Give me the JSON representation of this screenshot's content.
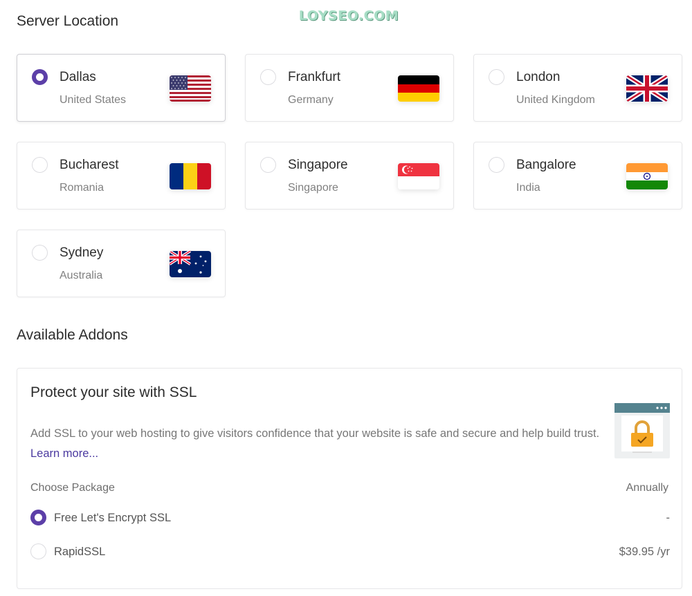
{
  "watermark": "LOYSEO.COM",
  "server_location": {
    "title": "Server Location",
    "locations": [
      {
        "city": "Dallas",
        "country": "United States",
        "flag": "us-flag-icon",
        "selected": true
      },
      {
        "city": "Frankfurt",
        "country": "Germany",
        "flag": "de-flag-icon",
        "selected": false
      },
      {
        "city": "London",
        "country": "United Kingdom",
        "flag": "gb-flag-icon",
        "selected": false
      },
      {
        "city": "Bucharest",
        "country": "Romania",
        "flag": "ro-flag-icon",
        "selected": false
      },
      {
        "city": "Singapore",
        "country": "Singapore",
        "flag": "sg-flag-icon",
        "selected": false
      },
      {
        "city": "Bangalore",
        "country": "India",
        "flag": "in-flag-icon",
        "selected": false
      },
      {
        "city": "Sydney",
        "country": "Australia",
        "flag": "au-flag-icon",
        "selected": false
      }
    ]
  },
  "addons": {
    "title": "Available Addons",
    "ssl": {
      "title": "Protect your site with SSL",
      "description": "Add SSL to your web hosting to give visitors confidence that your website is safe and secure and help build trust.",
      "learn_more": "Learn more...",
      "choose_package_label": "Choose Package",
      "period_label": "Annually",
      "illustration_icon": "ssl-padlock-icon",
      "packages": [
        {
          "name": "Free Let's Encrypt SSL",
          "price": "-",
          "selected": true
        },
        {
          "name": "RapidSSL",
          "price": "$39.95 /yr",
          "selected": false
        }
      ]
    }
  },
  "colors": {
    "accent": "#5c3fa8",
    "link": "#4b3aa0",
    "border": "#e6e6e8"
  }
}
